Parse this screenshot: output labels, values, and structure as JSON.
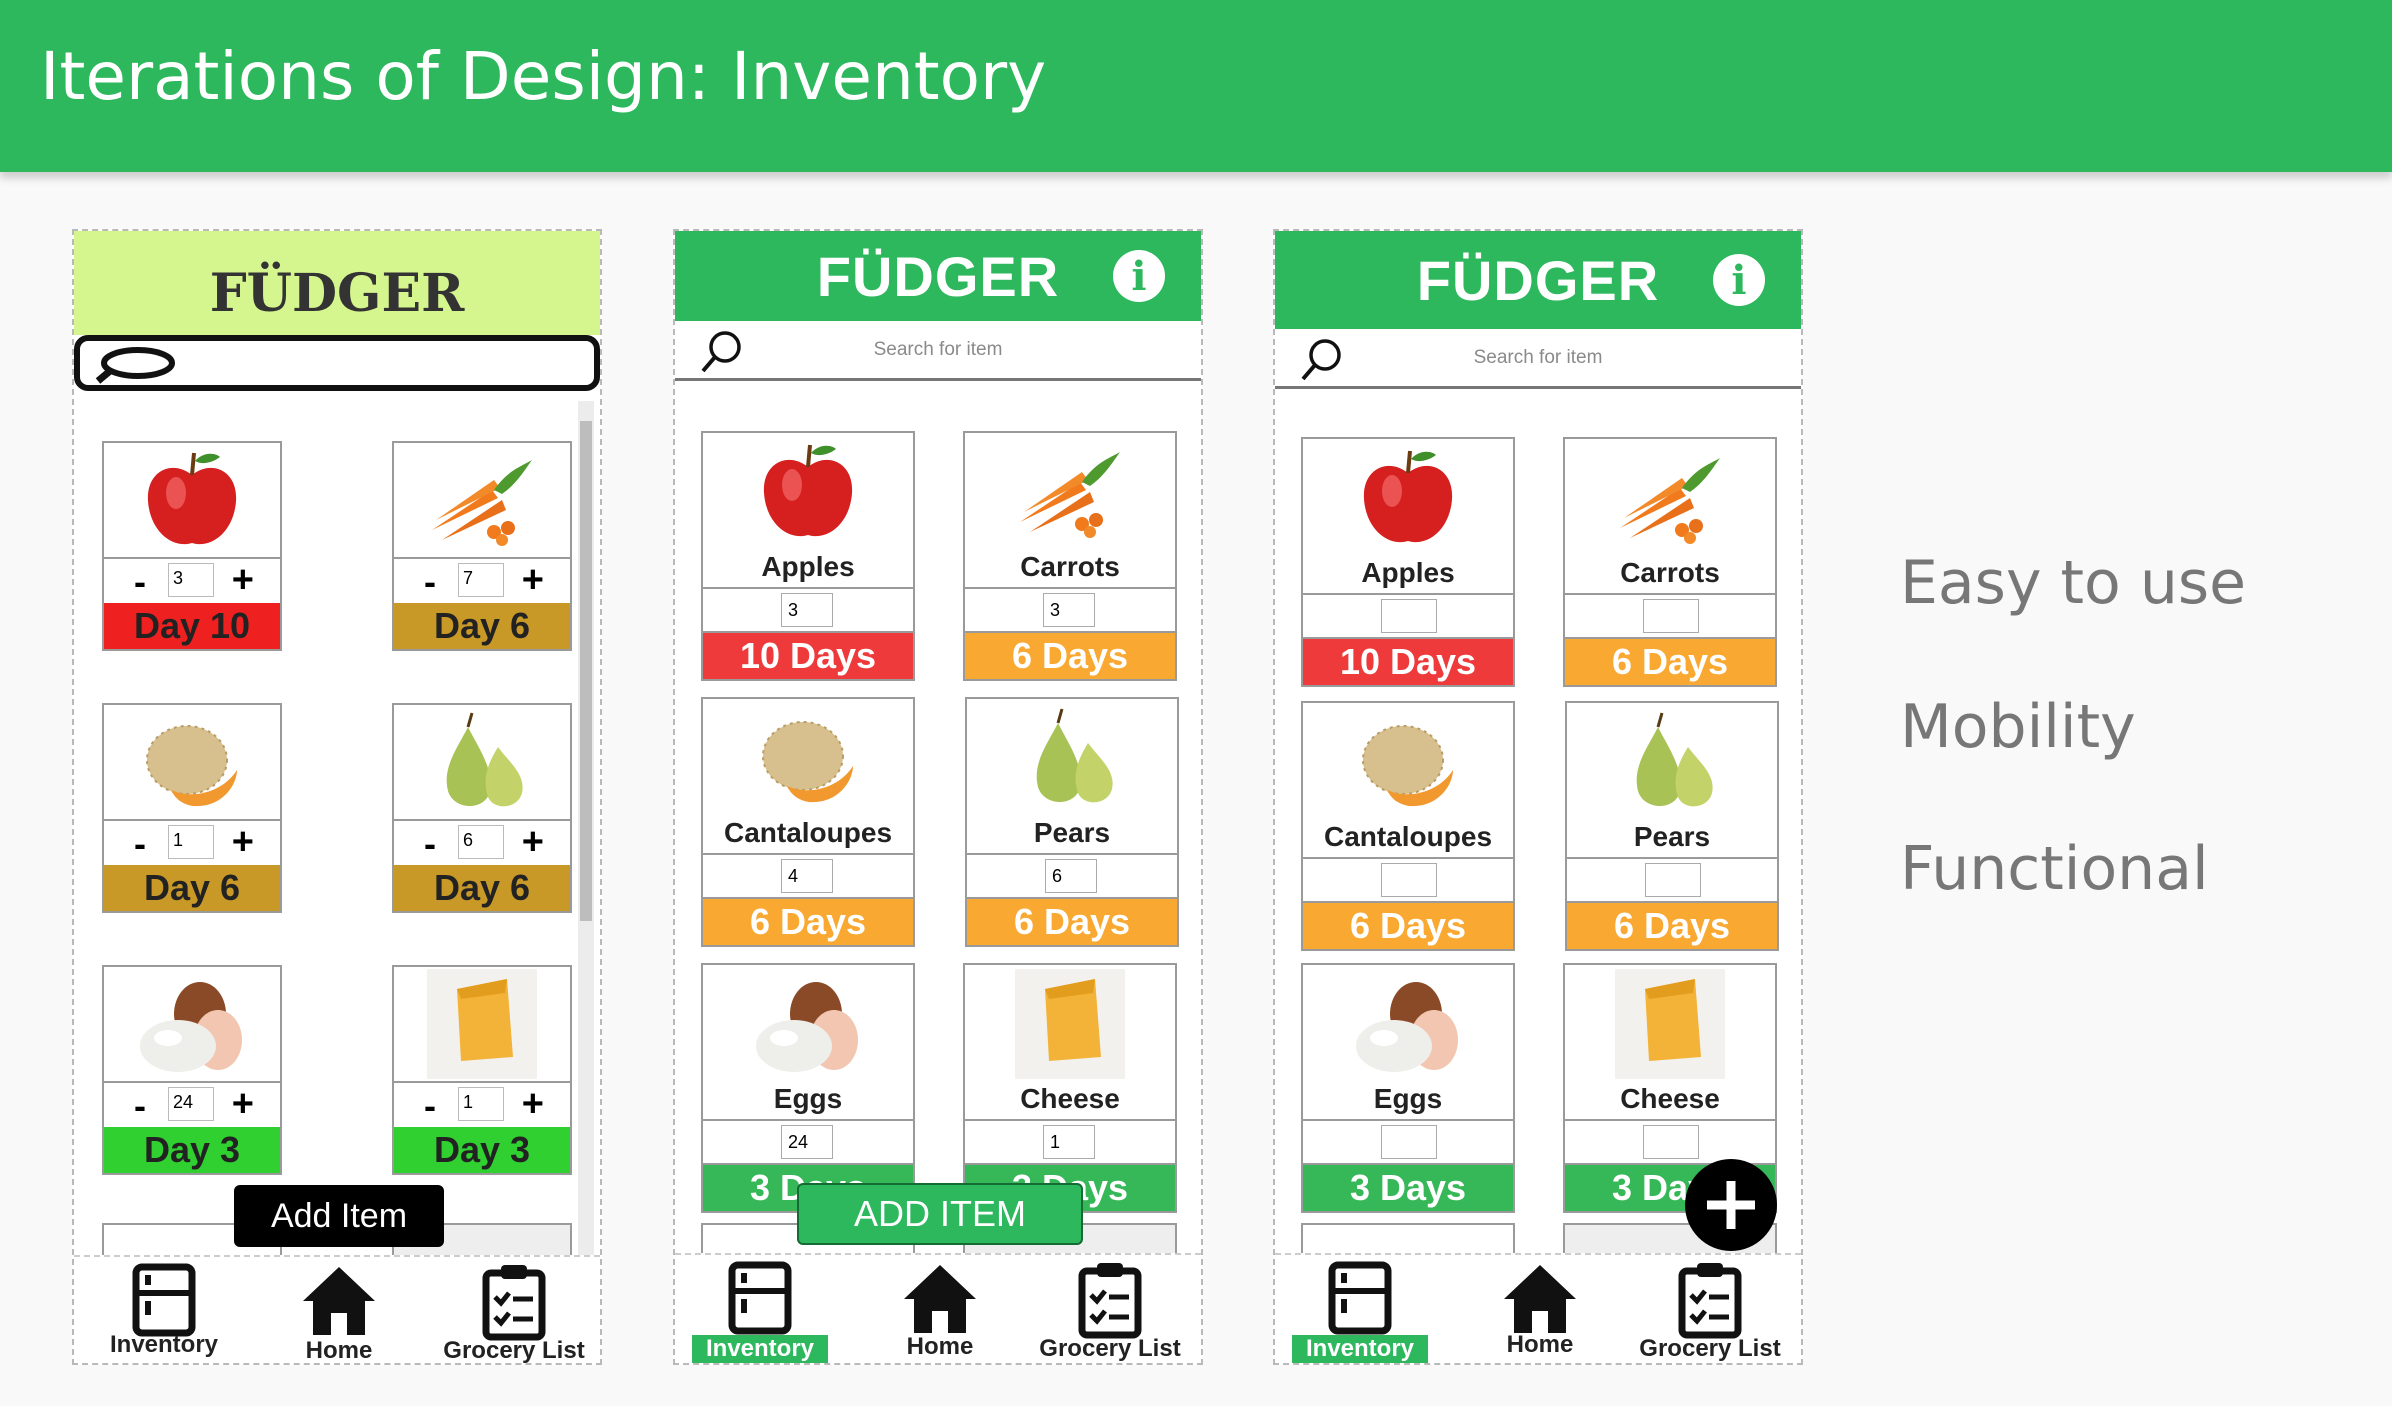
{
  "slide": {
    "title": "Iterations of Design: Inventory"
  },
  "brand": "FÜDGER",
  "search_placeholder": "Search for item",
  "v1": {
    "items": [
      {
        "qty": "3",
        "days": "Day 10"
      },
      {
        "qty": "7",
        "days": "Day 6"
      },
      {
        "qty": "1",
        "days": "Day 6"
      },
      {
        "qty": "6",
        "days": "Day 6"
      },
      {
        "qty": "24",
        "days": "Day 3"
      },
      {
        "qty": "1",
        "days": "Day 3"
      }
    ],
    "minus": "-",
    "plus": "+",
    "add_item": "Add Item"
  },
  "v2": {
    "items": [
      {
        "name": "Apples",
        "qty": "3",
        "days": "10 Days"
      },
      {
        "name": "Carrots",
        "qty": "3",
        "days": "6 Days"
      },
      {
        "name": "Cantaloupes",
        "qty": "4",
        "days": "6 Days"
      },
      {
        "name": "Pears",
        "qty": "6",
        "days": "6 Days"
      },
      {
        "name": "Eggs",
        "qty": "24",
        "days": "3 Days"
      },
      {
        "name": "Cheese",
        "qty": "1",
        "days": "3 Days"
      }
    ],
    "add_item": "ADD ITEM"
  },
  "v3": {
    "items": [
      {
        "name": "Apples",
        "days": "10 Days"
      },
      {
        "name": "Carrots",
        "days": "6 Days"
      },
      {
        "name": "Cantaloupes",
        "days": "6 Days"
      },
      {
        "name": "Pears",
        "days": "6 Days"
      },
      {
        "name": "Eggs",
        "days": "3 Days"
      },
      {
        "name": "Cheese",
        "days": "3 Days"
      }
    ]
  },
  "nav": {
    "inventory": "Inventory",
    "home": "Home",
    "grocery": "Grocery List"
  },
  "bullets": [
    "Easy to use",
    "Mobility",
    "Functional"
  ],
  "colors": {
    "green": "#2db85d",
    "red": "#ee3a3a",
    "orange": "#f9a832",
    "lime": "#d5f58e"
  }
}
